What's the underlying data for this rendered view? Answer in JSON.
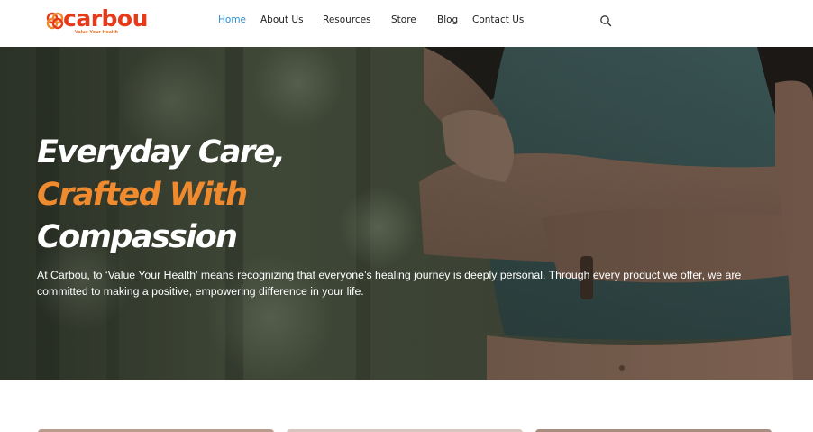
{
  "header": {
    "logo": {
      "name": "carbou",
      "tagline": "Value Your Health"
    },
    "nav": [
      {
        "label": "Home",
        "active": true
      },
      {
        "label": "About Us",
        "active": false
      },
      {
        "label": "Resources",
        "active": false
      },
      {
        "label": "Store",
        "active": false
      },
      {
        "label": "Blog",
        "active": false
      },
      {
        "label": "Contact Us",
        "active": false
      }
    ],
    "search_icon": "search-icon"
  },
  "hero": {
    "title_line_1": "Everyday Care,",
    "title_line_2": "Crafted With",
    "title_line_3": "Compassion",
    "description": "At Carbou, to ‘Value Your Health’ means recognizing that everyone’s healing journey is deeply personal. Through every product we offer, we are committed to making a positive, empowering difference in your life."
  },
  "colors": {
    "brand_red": "#e63a1a",
    "accent_orange": "#f08a2e",
    "nav_active": "#2e8fd4",
    "text_dark": "#222222"
  }
}
